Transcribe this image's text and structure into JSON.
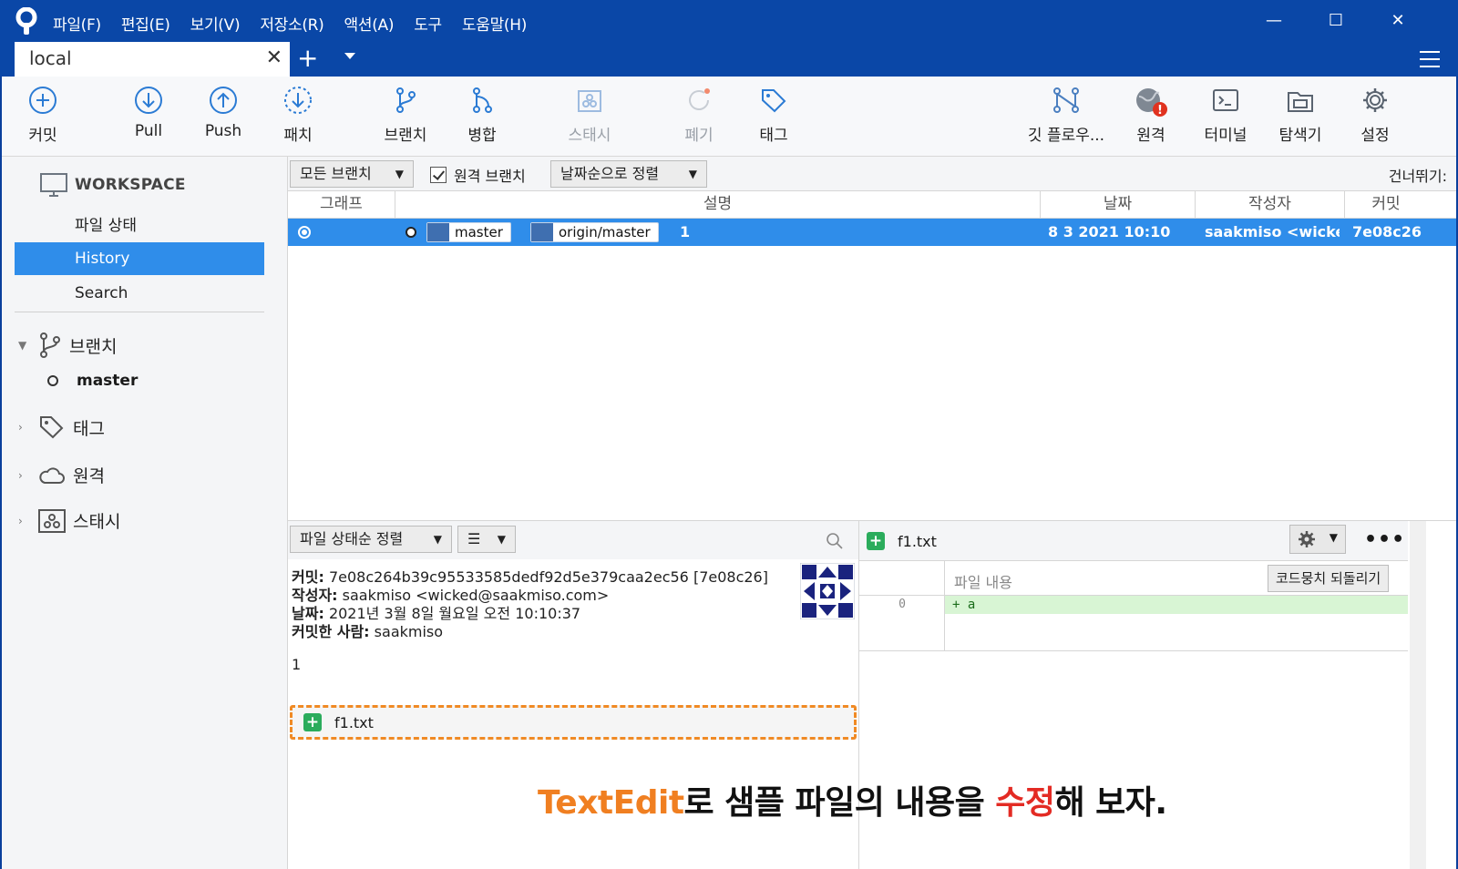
{
  "menu": [
    "파일(F)",
    "편집(E)",
    "보기(V)",
    "저장소(R)",
    "액션(A)",
    "도구",
    "도움말(H)"
  ],
  "window": {
    "minimize": "—",
    "maximize": "☐",
    "close": "✕"
  },
  "tab": {
    "title": "local",
    "close": "✕",
    "add": "+"
  },
  "toolbar": {
    "commit": "커밋",
    "pull": "Pull",
    "push": "Push",
    "patch": "패치",
    "branch": "브랜치",
    "merge": "병합",
    "stash": "스태시",
    "discard": "폐기",
    "tag": "태그",
    "gitflow": "깃 플로우...",
    "remote": "원격",
    "terminal": "터미널",
    "explorer": "탐색기",
    "settings": "설정",
    "remote_badge": "!"
  },
  "sidebar": {
    "workspace": "WORKSPACE",
    "items": [
      "파일 상태",
      "History",
      "Search"
    ],
    "active_item": "History",
    "sections": [
      "브랜치",
      "태그",
      "원격",
      "스태시"
    ],
    "branches": [
      "master"
    ]
  },
  "filter": {
    "branch_select": "모든 브랜치",
    "remote_branches": "원격 브랜치",
    "remote_branches_checked": true,
    "sort_select": "날짜순으로 정렬",
    "jump": "건너뛰기:"
  },
  "columns": [
    "그래프",
    "설명",
    "날짜",
    "작성자",
    "커밋"
  ],
  "commits": [
    {
      "branches": [
        "master",
        "origin/master"
      ],
      "message": "1",
      "date": "8 3 2021 10:10",
      "author": "saakmiso <wicked@saakmiso.com>",
      "hash": "7e08c26"
    }
  ],
  "details": {
    "sort_select": "파일 상태순 정렬",
    "list_select": "☰",
    "commit_label": "커밋:",
    "commit_value": "7e08c264b39c95533585dedf92d5e379caa2ec56 [7e08c26]",
    "author_label": "작성자:",
    "author_value": "saakmiso <wicked@saakmiso.com>",
    "date_label": "날짜:",
    "date_value": "2021년 3월 8일 월요일 오전 10:10:37",
    "committer_label": "커밋한 사람:",
    "committer_value": "saakmiso",
    "message": "1",
    "files": [
      "f1.txt"
    ]
  },
  "diff": {
    "file": "f1.txt",
    "hunk_label": "파일 내용",
    "revert_button": "코드뭉치 되돌리기",
    "line_number": "0",
    "line_text": "+ a",
    "more": "•••"
  },
  "caption": {
    "part1": "TextEdit",
    "part2": "로 샘플 파일의 내용을 ",
    "part3": "수정",
    "part4": "해 보자."
  },
  "colors": {
    "titlebar": "#0a47a7",
    "selection": "#2f8dea",
    "added_green": "#2bac5c",
    "highlight_orange": "#f08a24",
    "caption_orange": "#f07f21",
    "caption_red": "#e32b24"
  }
}
